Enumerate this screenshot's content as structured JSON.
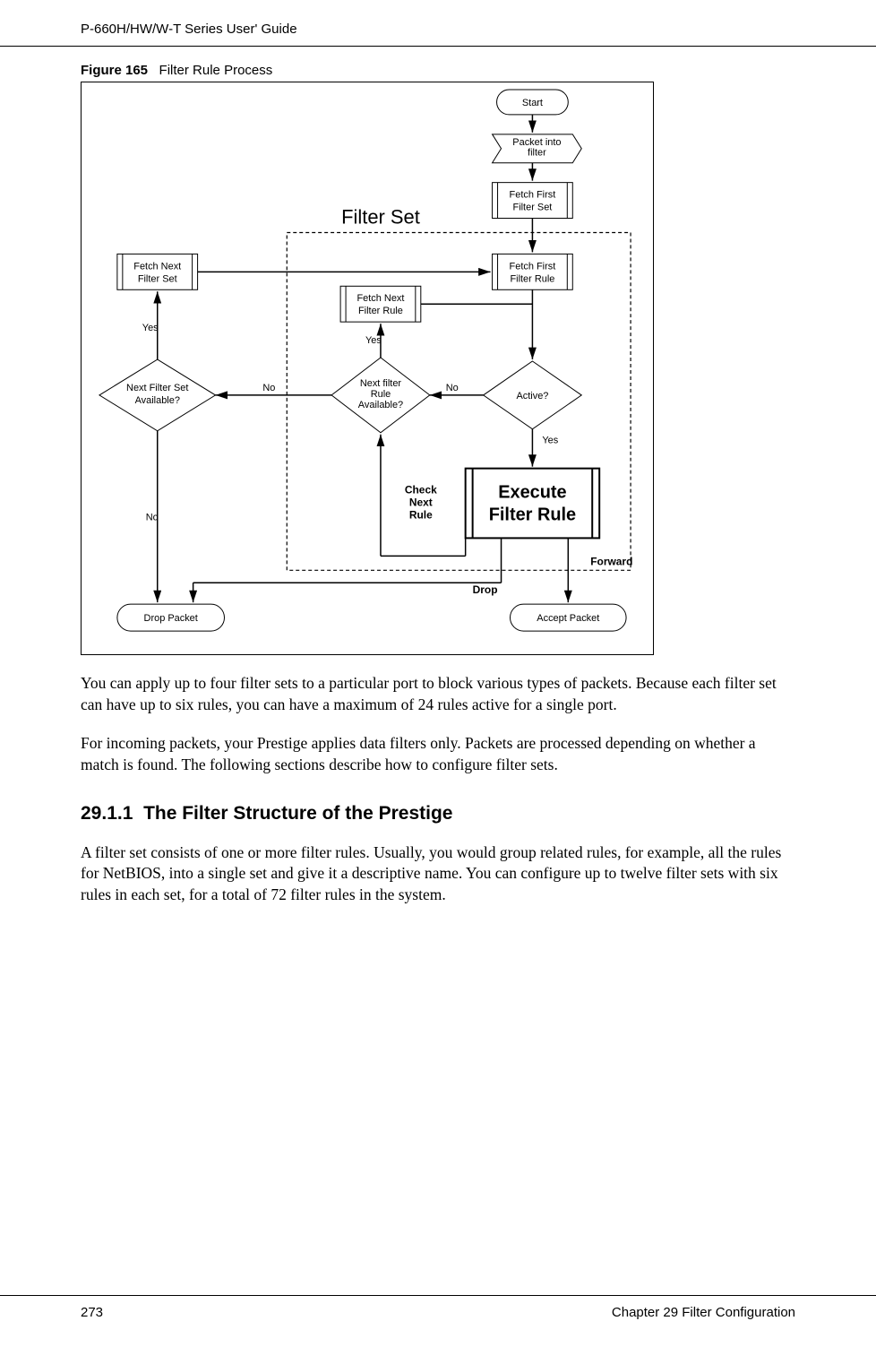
{
  "header": {
    "left": "P-660H/HW/W-T Series User' Guide"
  },
  "figure": {
    "caption_prefix": "Figure 165",
    "caption_text": "Filter Rule Process"
  },
  "diagram": {
    "filter_set_title": "Filter Set",
    "start": "Start",
    "packet_into_filter_l1": "Packet into",
    "packet_into_filter_l2": "filter",
    "fetch_first_set_l1": "Fetch First",
    "fetch_first_set_l2": "Filter Set",
    "fetch_first_rule_l1": "Fetch First",
    "fetch_first_rule_l2": "Filter Rule",
    "fetch_next_set_l1": "Fetch Next",
    "fetch_next_set_l2": "Filter Set",
    "fetch_next_rule_l1": "Fetch Next",
    "fetch_next_rule_l2": "Filter Rule",
    "next_set_avail_l1": "Next Filter Set",
    "next_set_avail_l2": "Available?",
    "next_rule_avail_l1": "Next filter",
    "next_rule_avail_l2": "Rule",
    "next_rule_avail_l3": "Available?",
    "active": "Active?",
    "execute_l1": "Execute",
    "execute_l2": "Filter Rule",
    "check_next_l1": "Check",
    "check_next_l2": "Next",
    "check_next_l3": "Rule",
    "drop_packet": "Drop Packet",
    "accept_packet": "Accept Packet",
    "yes": "Yes",
    "no": "No",
    "drop": "Drop",
    "forward": "Forward"
  },
  "paragraphs": {
    "p1": "You can apply up to four filter sets to a particular port to block various types of packets. Because each filter set can have up to six rules, you can have a maximum of 24 rules active for a single port.",
    "p2": "For incoming packets, your Prestige applies data filters only. Packets are processed depending on whether a match is found. The following sections describe how to configure filter sets."
  },
  "section": {
    "number": "29.1.1",
    "title": "The Filter Structure of the Prestige",
    "body": "A filter set consists of one or more filter rules. Usually, you would group related rules, for example, all the rules for NetBIOS, into a single set and give it a descriptive name. You can configure up to twelve filter sets with six rules in each set, for a total of 72 filter rules in the system."
  },
  "footer": {
    "page": "273",
    "chapter": "Chapter 29 Filter Configuration"
  }
}
